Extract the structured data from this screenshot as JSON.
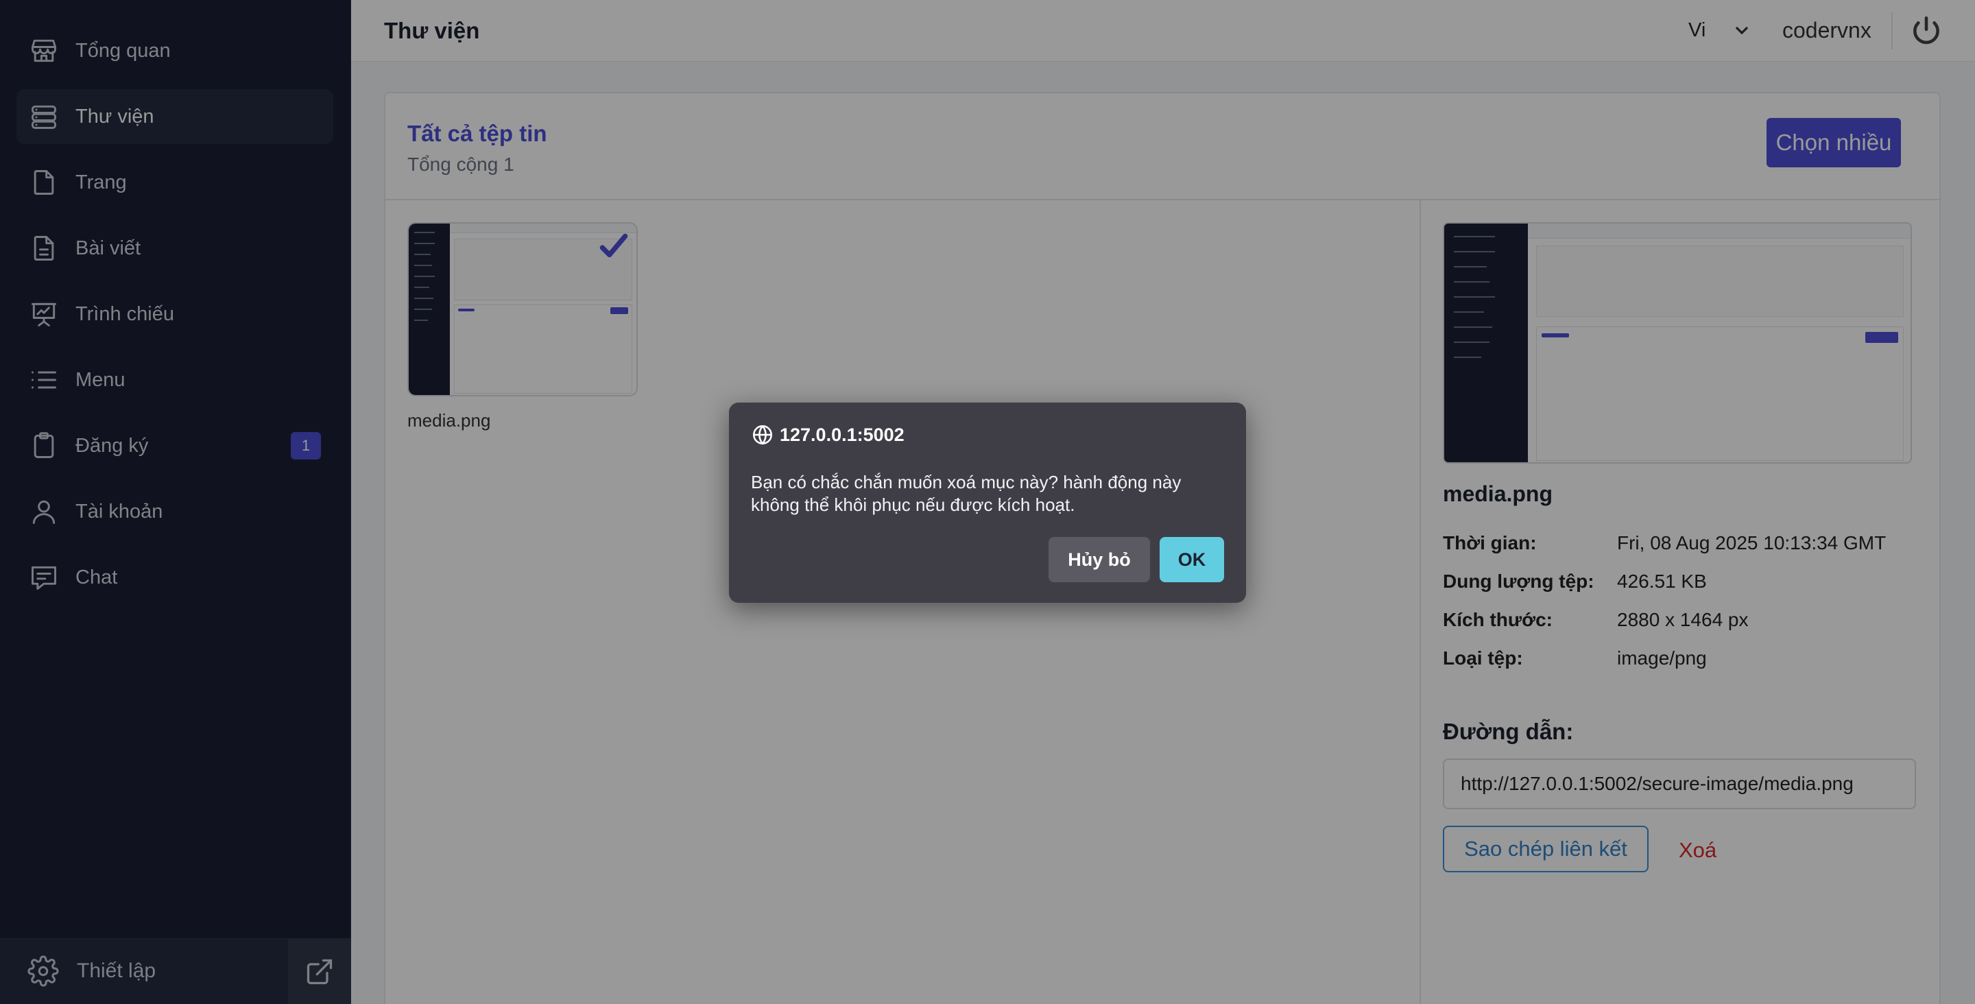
{
  "sidebar": {
    "items": [
      {
        "label": "Tổng quan",
        "icon": "store-icon"
      },
      {
        "label": "Thư viện",
        "icon": "database-icon",
        "active": true
      },
      {
        "label": "Trang",
        "icon": "file-icon"
      },
      {
        "label": "Bài viết",
        "icon": "file-text-icon"
      },
      {
        "label": "Trình chiếu",
        "icon": "presentation-icon"
      },
      {
        "label": "Menu",
        "icon": "list-icon"
      },
      {
        "label": "Đăng ký",
        "icon": "clipboard-icon",
        "badge": "1"
      },
      {
        "label": "Tài khoản",
        "icon": "user-icon"
      },
      {
        "label": "Chat",
        "icon": "chat-icon"
      }
    ],
    "footer": {
      "settings_label": "Thiết lập",
      "settings_icon": "gear-icon",
      "external_icon": "external-link-icon"
    }
  },
  "header": {
    "title": "Thư viện",
    "language": "Vi",
    "username": "codervnx"
  },
  "library": {
    "title": "Tất cả tệp tin",
    "total": "Tổng cộng 1",
    "select_multiple": "Chọn nhiều",
    "files": [
      {
        "name": "media.png",
        "selected": true
      }
    ]
  },
  "detail": {
    "file_name": "media.png",
    "meta": [
      {
        "key": "Thời gian:",
        "value": "Fri, 08 Aug 2025 10:13:34 GMT"
      },
      {
        "key": "Dung lượng tệp:",
        "value": "426.51 KB"
      },
      {
        "key": "Kích thước:",
        "value": "2880 x 1464 px"
      },
      {
        "key": "Loại tệp:",
        "value": "image/png"
      }
    ],
    "path_label": "Đường dẫn:",
    "path_value": "http://127.0.0.1:5002/secure-image/media.png",
    "copy_label": "Sao chép liên kết",
    "delete_label": "Xoá"
  },
  "dialog": {
    "origin": "127.0.0.1:5002",
    "message": "Bạn có chắc chắn muốn xoá mục này? hành động này không thể khôi phục nếu được kích hoạt.",
    "cancel_label": "Hủy bỏ",
    "ok_label": "OK"
  },
  "colors": {
    "sidebar_bg": "#1b2135",
    "accent": "#4e4fd6",
    "danger": "#d8282b",
    "link": "#2f80c9",
    "dialog_ok": "#62cde0"
  }
}
